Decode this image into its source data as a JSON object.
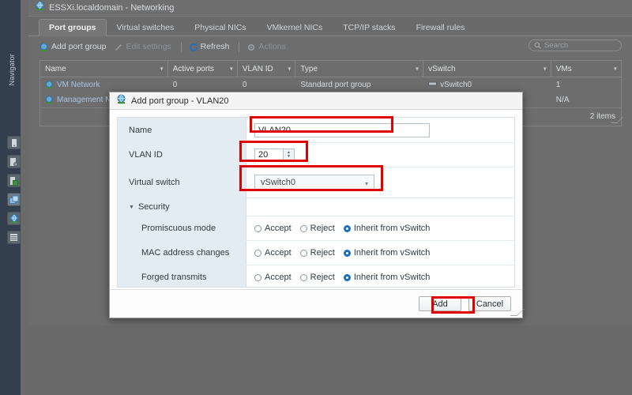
{
  "left_rail": {
    "navigator_label": "Navigator",
    "buttons": [
      {
        "name": "host-icon",
        "glyph": "▯"
      },
      {
        "name": "vm-settings-icon",
        "glyph": "▤"
      },
      {
        "name": "virtual-machines-icon",
        "glyph": "▤"
      },
      {
        "name": "networking-stack-icon",
        "glyph": "❑"
      },
      {
        "name": "networking-globe-icon",
        "glyph": "◉"
      },
      {
        "name": "storage-icon",
        "glyph": "▤"
      }
    ]
  },
  "header": {
    "title": "ESSXi.localdomain - Networking",
    "icon": "globe-icon"
  },
  "tabs": [
    {
      "label": "Port groups",
      "selected": true
    },
    {
      "label": "Virtual switches",
      "selected": false
    },
    {
      "label": "Physical NICs",
      "selected": false
    },
    {
      "label": "VMkernel NICs",
      "selected": false
    },
    {
      "label": "TCP/IP stacks",
      "selected": false
    },
    {
      "label": "Firewall rules",
      "selected": false
    }
  ],
  "toolbar": {
    "add_port_group": "Add port group",
    "edit_settings": "Edit settings",
    "refresh": "Refresh",
    "actions": "Actions"
  },
  "search": {
    "placeholder": "Search",
    "value": ""
  },
  "table": {
    "columns": [
      "Name",
      "Active ports",
      "VLAN ID",
      "Type",
      "vSwitch",
      "VMs"
    ],
    "rows": [
      {
        "name": "VM Network",
        "active_ports": "0",
        "vlan_id": "0",
        "type": "Standard port group",
        "vswitch": "vSwitch0",
        "vms": "1"
      },
      {
        "name": "Management Ne",
        "active_ports": "",
        "vlan_id": "",
        "type": "",
        "vswitch": "",
        "vms": "N/A"
      }
    ],
    "footer_count": "2 items"
  },
  "dialog": {
    "title": "Add port group - VLAN20",
    "fields": {
      "name_label": "Name",
      "name_value": "VLAN20",
      "vlan_label": "VLAN ID",
      "vlan_value": "20",
      "vswitch_label": "Virtual switch",
      "vswitch_value": "vSwitch0"
    },
    "security": {
      "heading": "Security",
      "rows": [
        {
          "label": "Promiscuous mode",
          "options": [
            "Accept",
            "Reject",
            "Inherit from vSwitch"
          ],
          "selected": "Inherit from vSwitch"
        },
        {
          "label": "MAC address changes",
          "options": [
            "Accept",
            "Reject",
            "Inherit from vSwitch"
          ],
          "selected": "Inherit from vSwitch"
        },
        {
          "label": "Forged transmits",
          "options": [
            "Accept",
            "Reject",
            "Inherit from vSwitch"
          ],
          "selected": "Inherit from vSwitch"
        }
      ]
    },
    "buttons": {
      "add": "Add",
      "cancel": "Cancel"
    }
  },
  "annotations": {
    "accent_color": "#e00000",
    "highlighted": [
      "name-field",
      "vlan-id-field",
      "virtual-switch-select",
      "add-button"
    ]
  }
}
